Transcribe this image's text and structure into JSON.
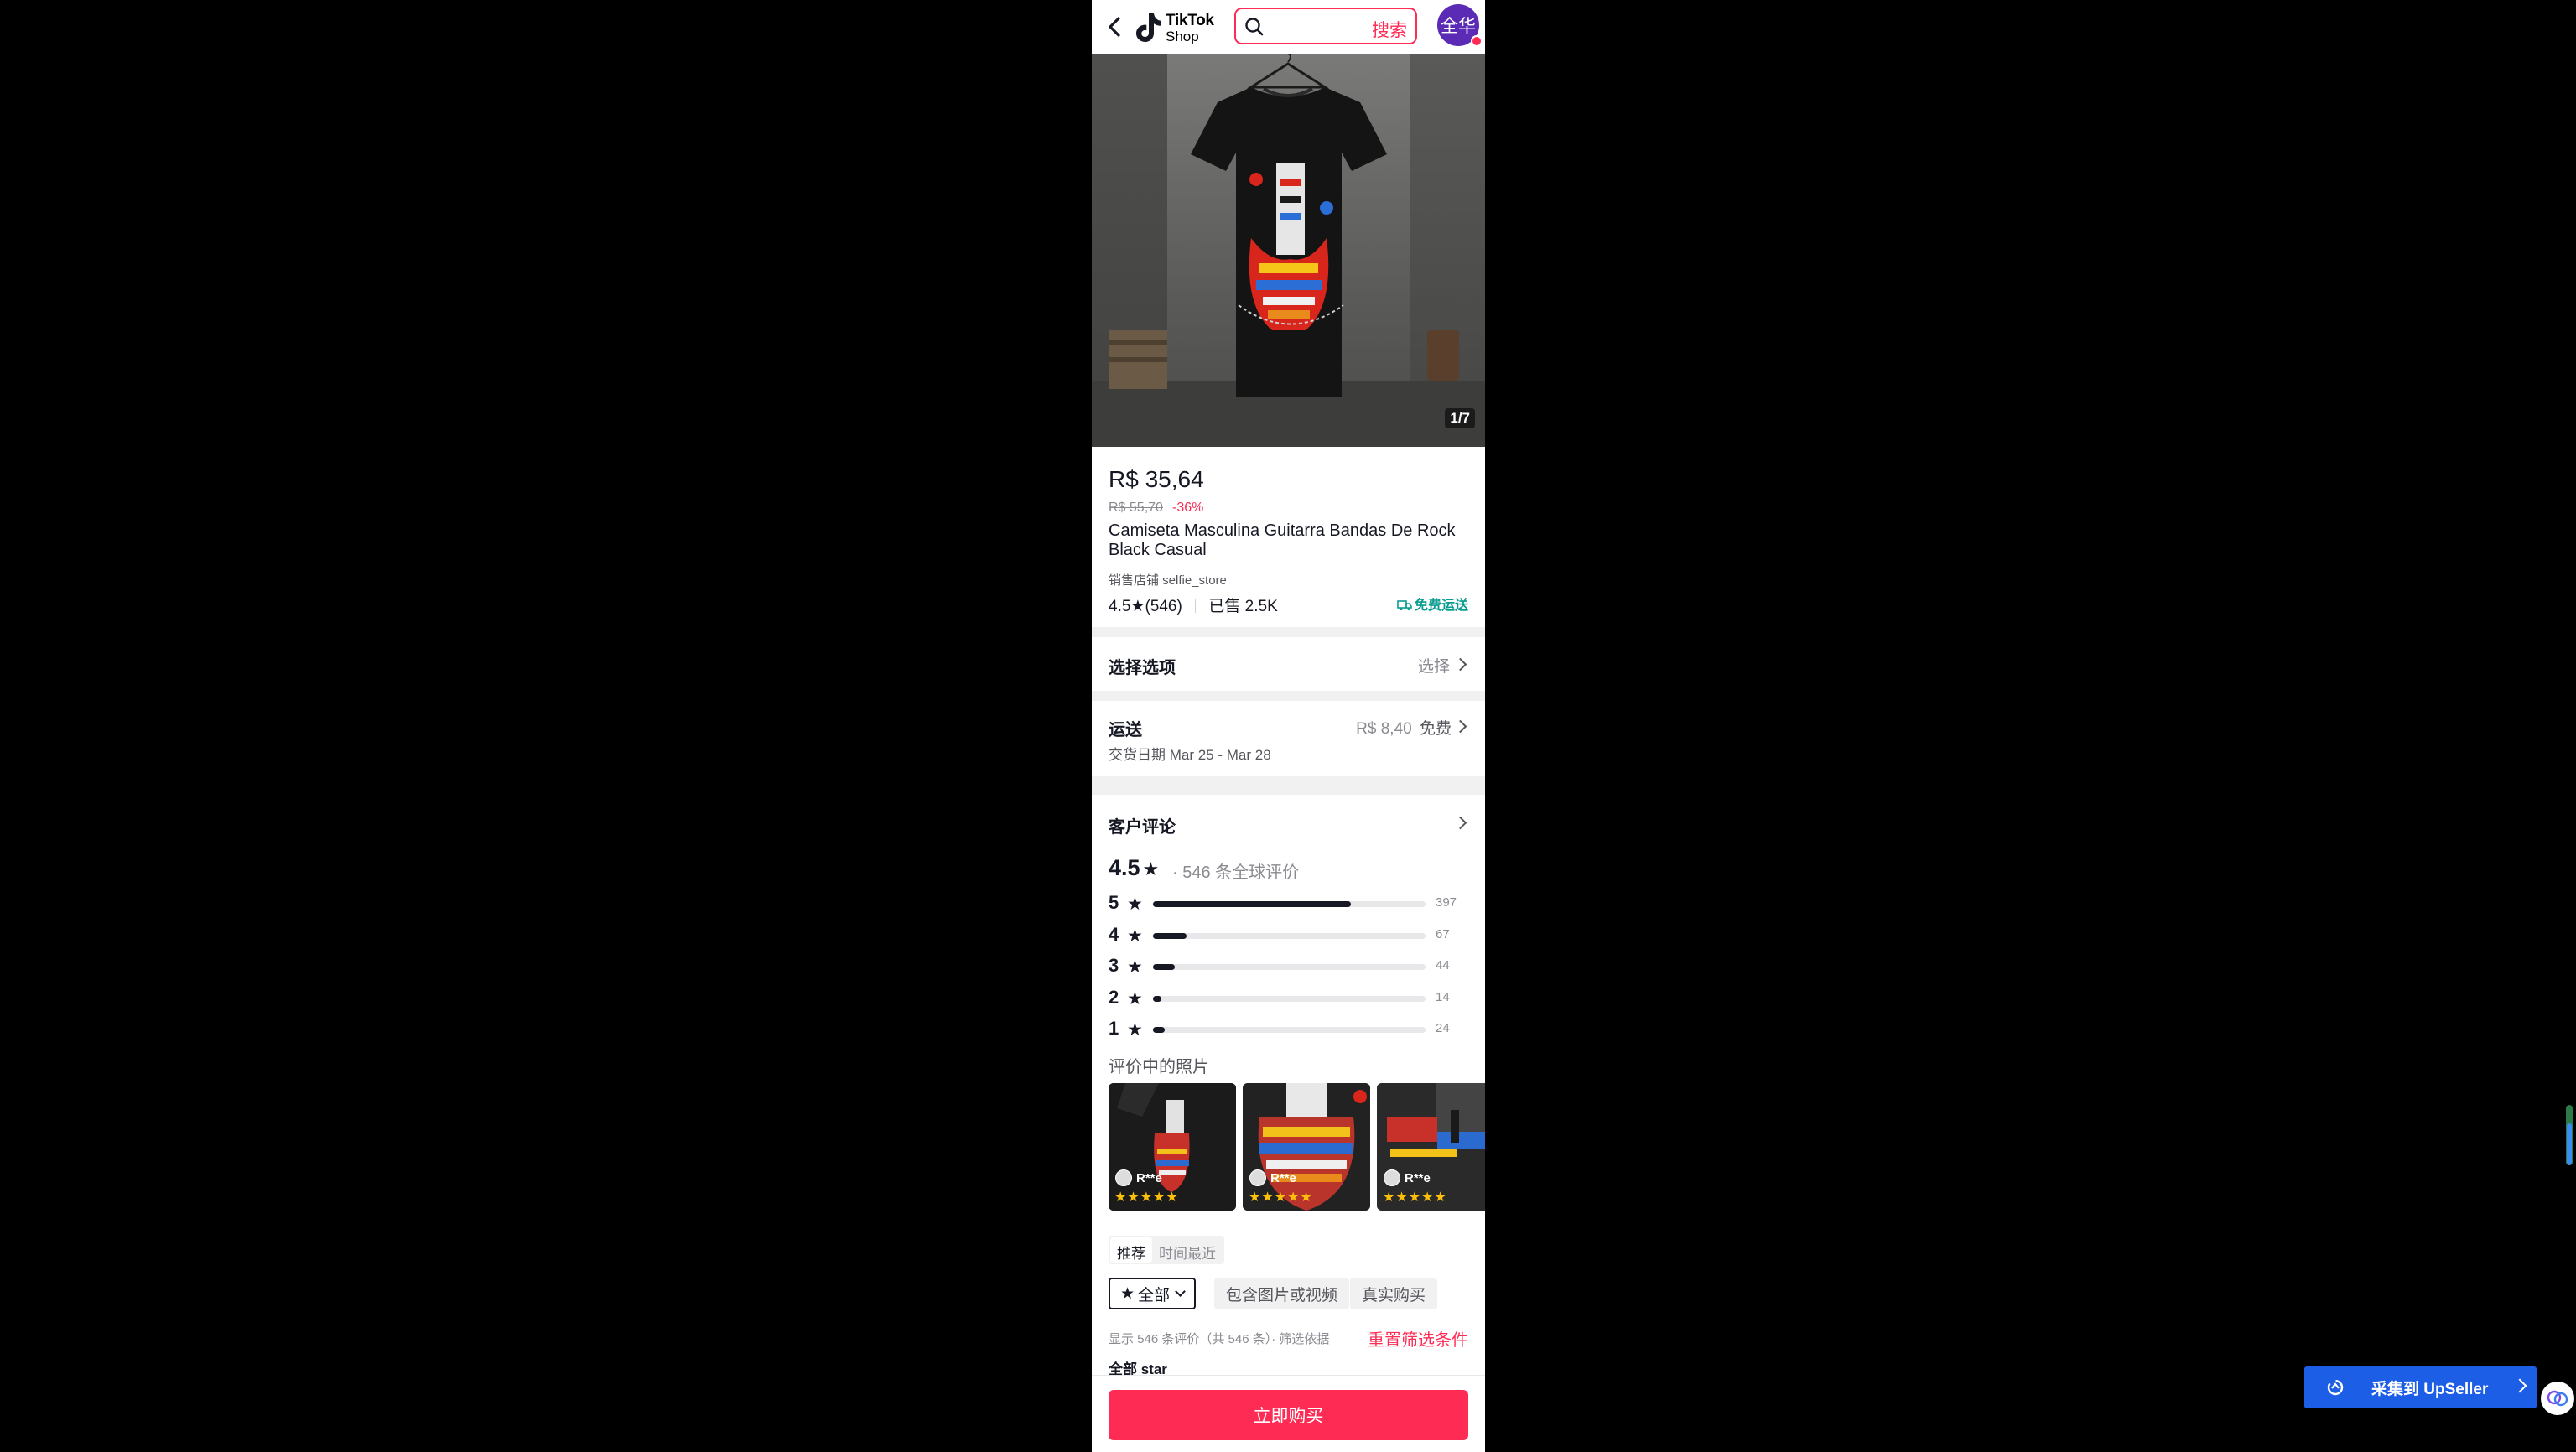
{
  "header": {
    "logo_line1": "TikTok",
    "logo_line2": "Shop",
    "search_label": "搜索",
    "avatar_text": "全华"
  },
  "product": {
    "image_counter": "1/7",
    "price": "R$ 35,64",
    "original_price": "R$ 55,70",
    "discount": "-36%",
    "title": "Camiseta Masculina Guitarra Bandas De Rock Black Casual",
    "store": "销售店铺 selfie_store",
    "rating": "4.5",
    "rating_count": "(546)",
    "sold": "已售 2.5K",
    "free_shipping": "免费运送"
  },
  "options": {
    "title": "选择选项",
    "action": "选择"
  },
  "shipping": {
    "title": "运送",
    "old_fee": "R$ 8,40",
    "fee": "免费",
    "delivery": "交货日期 Mar 25 - Mar 28"
  },
  "reviews": {
    "title": "客户评论",
    "average": "4.5",
    "total": "· 546 条全球评价",
    "breakdown": [
      {
        "stars": "5",
        "count": "397",
        "fraction": 0.727
      },
      {
        "stars": "4",
        "count": "67",
        "fraction": 0.123
      },
      {
        "stars": "3",
        "count": "44",
        "fraction": 0.081
      },
      {
        "stars": "2",
        "count": "14",
        "fraction": 0.026
      },
      {
        "stars": "1",
        "count": "24",
        "fraction": 0.044
      }
    ],
    "photos_label": "评价中的照片",
    "photos": [
      {
        "user": "R**e",
        "stars": "★★★★★"
      },
      {
        "user": "R**e",
        "stars": "★★★★★"
      },
      {
        "user": "R**e",
        "stars": "★★★★★"
      }
    ],
    "sort_tabs": [
      "推荐",
      "时间最近"
    ],
    "filters": {
      "all": "全部",
      "media": "包含图片或视频",
      "verified": "真实购买"
    },
    "showing": "显示 546 条评价（共 546 条）· 筛选依据",
    "reset": "重置筛选条件",
    "active_filter": "全部 star"
  },
  "buy_button": "立即购买",
  "upseller": {
    "label": "采集到 UpSeller"
  },
  "colors": {
    "accent": "#fe2c55",
    "teal": "#0a9d91",
    "upseller_blue": "#1d5ee7"
  }
}
